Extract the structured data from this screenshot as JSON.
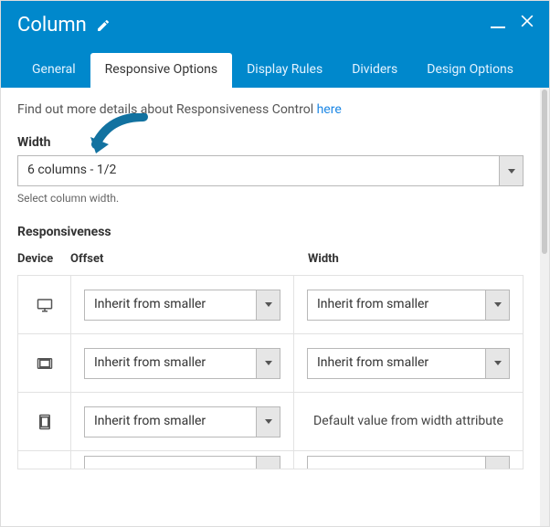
{
  "header": {
    "title": "Column"
  },
  "tabs": {
    "items": [
      {
        "label": "General"
      },
      {
        "label": "Responsive Options"
      },
      {
        "label": "Display Rules"
      },
      {
        "label": "Dividers"
      },
      {
        "label": "Design Options"
      }
    ],
    "active_index": 1
  },
  "intro": {
    "text": "Find out more details about Responsiveness Control ",
    "link_text": "here"
  },
  "width": {
    "label": "Width",
    "value": "6 columns - 1/2",
    "helper": "Select column width."
  },
  "responsiveness": {
    "section_label": "Responsiveness",
    "headers": {
      "device": "Device",
      "offset": "Offset",
      "width": "Width"
    },
    "inherit_label": "Inherit from smaller",
    "default_label": "Default value from width attribute",
    "rows": [
      {
        "device_icon": "desktop",
        "offset": "inherit",
        "width": "inherit"
      },
      {
        "device_icon": "tablet-landscape",
        "offset": "inherit",
        "width": "inherit"
      },
      {
        "device_icon": "tablet-portrait",
        "offset": "inherit",
        "width": "default"
      }
    ]
  },
  "icons": {
    "edit": "pencil-icon",
    "minimize": "minimize-icon",
    "close": "close-icon",
    "dropdown": "chevron-down-icon"
  },
  "colors": {
    "accent": "#0088cc"
  }
}
